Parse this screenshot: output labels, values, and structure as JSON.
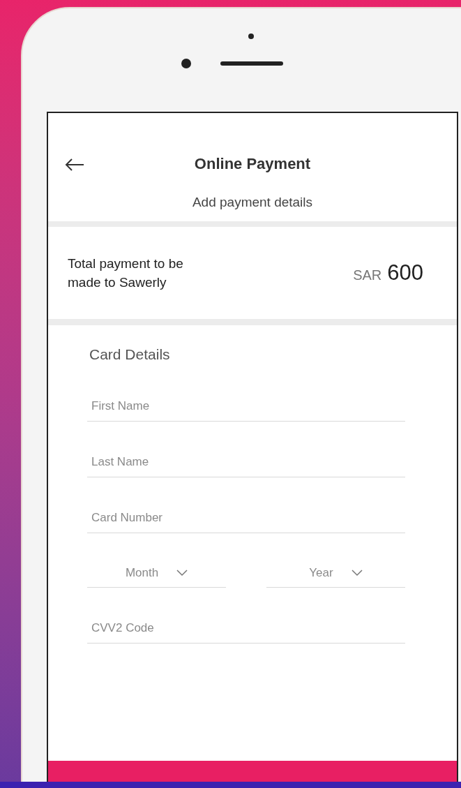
{
  "header": {
    "title": "Online Payment",
    "subtitle": "Add payment details"
  },
  "total": {
    "label": "Total payment to be made to Sawerly",
    "currency": "SAR",
    "amount": "600"
  },
  "card_details": {
    "title": "Card Details",
    "fields": [
      {
        "kind": "text",
        "placeholder": "First Name"
      },
      {
        "kind": "text",
        "placeholder": "Last Name"
      },
      {
        "kind": "text",
        "placeholder": "Card Number"
      },
      {
        "kind": "select",
        "placeholder": "Month"
      },
      {
        "kind": "select",
        "placeholder": "Year"
      },
      {
        "kind": "text",
        "placeholder": "CVV2 Code"
      }
    ]
  }
}
